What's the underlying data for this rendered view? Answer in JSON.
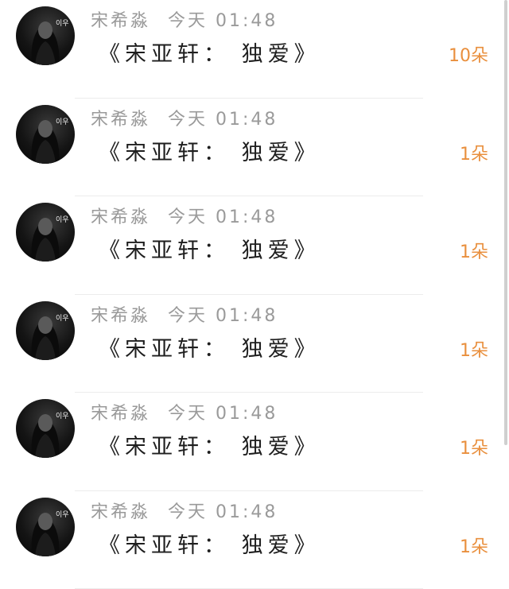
{
  "comments": [
    {
      "user": "宋希淼",
      "time": "今天 01:48",
      "message": "《宋亚轩： 独爱》",
      "flowers": "10朵",
      "avatar_tag": "이우"
    },
    {
      "user": "宋希淼",
      "time": "今天 01:48",
      "message": "《宋亚轩： 独爱》",
      "flowers": "1朵",
      "avatar_tag": "이우"
    },
    {
      "user": "宋希淼",
      "time": "今天 01:48",
      "message": "《宋亚轩： 独爱》",
      "flowers": "1朵",
      "avatar_tag": "이우"
    },
    {
      "user": "宋希淼",
      "time": "今天 01:48",
      "message": "《宋亚轩： 独爱》",
      "flowers": "1朵",
      "avatar_tag": "이우"
    },
    {
      "user": "宋希淼",
      "time": "今天 01:48",
      "message": "《宋亚轩： 独爱》",
      "flowers": "1朵",
      "avatar_tag": "이우"
    },
    {
      "user": "宋希淼",
      "time": "今天 01:48",
      "message": "《宋亚轩： 独爱》",
      "flowers": "1朵",
      "avatar_tag": "이우"
    }
  ],
  "colors": {
    "flower_count": "#e98f3d",
    "meta_text": "#9a9a9a",
    "message_text": "#1e1e1e"
  }
}
